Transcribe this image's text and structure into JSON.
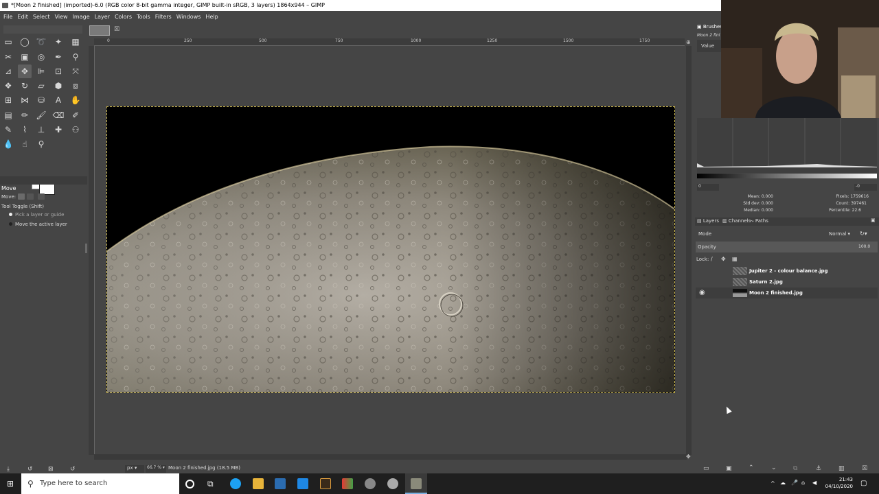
{
  "window": {
    "title": "*[Moon 2 finished] (imported)-6.0 (RGB color 8-bit gamma integer, GIMP built-in sRGB, 3 layers) 1864x944 – GIMP"
  },
  "menu": [
    "File",
    "Edit",
    "Select",
    "View",
    "Image",
    "Layer",
    "Colors",
    "Tools",
    "Filters",
    "Windows",
    "Help"
  ],
  "tool_options": {
    "title": "Move",
    "move_label": "Move:",
    "tool_toggle": "Tool Toggle  (Shift)",
    "option1": "Pick a layer or guide",
    "option2": "Move the active layer"
  },
  "ruler": {
    "h": [
      "0",
      "250",
      "500",
      "750",
      "1000",
      "1250",
      "1500",
      "1750"
    ]
  },
  "status": {
    "unit": "px",
    "zoom": "66.7 %",
    "info": "Moon 2 finished.jpg (18.5 MB)"
  },
  "right_panel": {
    "brushes_tab": "Brushes",
    "brush_name": "Moon 2 fini",
    "histogram_channel": "Value",
    "range_min": "0",
    "range_max": "-0",
    "mean": "Mean: 0.000",
    "std_dev": "Std dev: 0.000",
    "median": "Median: 0.000",
    "pixels": "Pixels: 1759616",
    "count": "Count: 397461",
    "percentile": "Percentile: 22.6",
    "tabs": [
      "Layers",
      "Channels",
      "Paths"
    ],
    "mode_label": "Mode",
    "mode_value": "Normal",
    "opacity_label": "Opacity",
    "opacity_value": "100.0",
    "lock_label": "Lock:"
  },
  "layers": [
    {
      "name": "Jupiter 2 - colour balance.jpg",
      "visible": false
    },
    {
      "name": "Saturn 2.jpg",
      "visible": false
    },
    {
      "name": "Moon 2 finished.jpg",
      "visible": true
    }
  ],
  "taskbar": {
    "search_placeholder": "Type here to search",
    "time": "21:43",
    "date": "04/10/2020"
  }
}
